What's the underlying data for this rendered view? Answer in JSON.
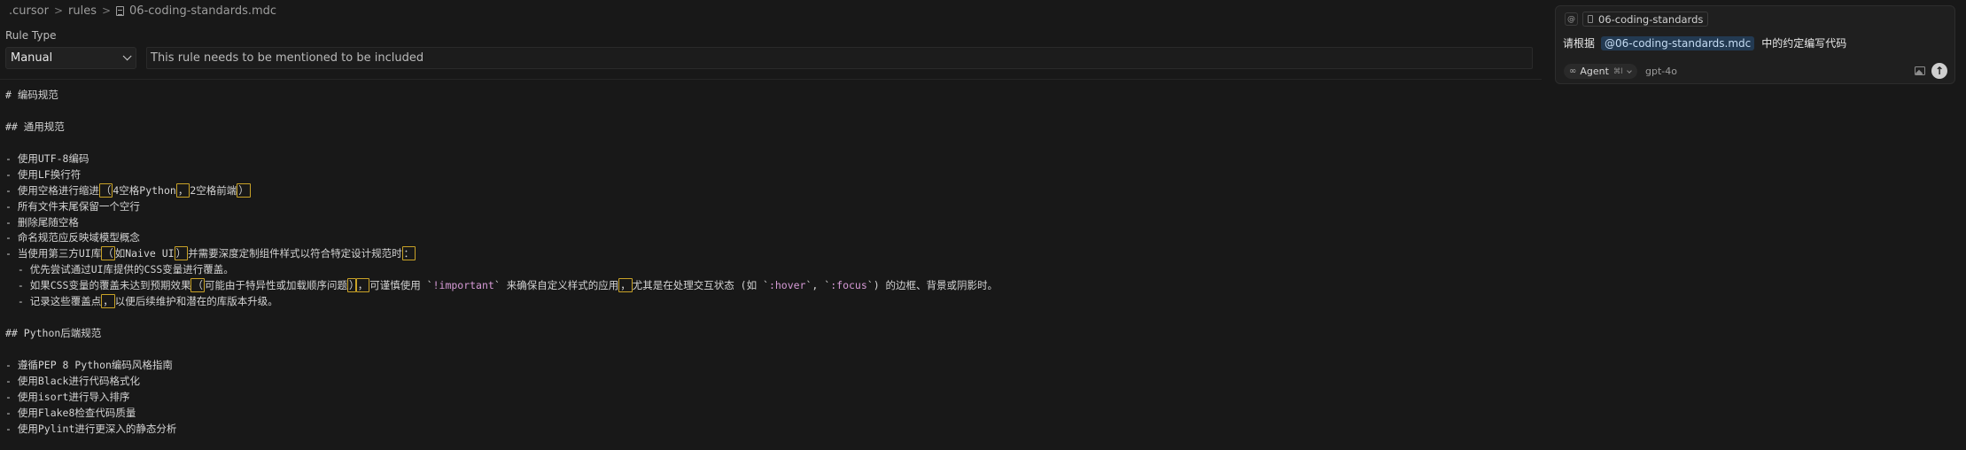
{
  "breadcrumb": {
    "root": ".cursor",
    "folder": "rules",
    "file": "06-coding-standards.mdc",
    "separator": ">"
  },
  "rule_type": {
    "label": "Rule Type",
    "value": "Manual",
    "description": "This rule needs to be mentioned to be included"
  },
  "code_lines": [
    "# 编码规范",
    "",
    "## 通用规范",
    "",
    "- 使用UTF-8编码",
    "- 使用LF换行符",
    "- 使用空格进行缩进（4空格Python，2空格前端）",
    "- 所有文件末尾保留一个空行",
    "- 删除尾随空格",
    "- 命名规范应反映域模型概念",
    "- 当使用第三方UI库（如Naive UI）并需要深度定制组件样式以符合特定设计规范时：",
    "  - 优先尝试通过UI库提供的CSS变量进行覆盖。",
    "  - 如果CSS变量的覆盖未达到预期效果（可能由于特异性或加载顺序问题），可谨慎使用 `!important` 来确保自定义样式的应用，尤其是在处理交互状态 (如 `:hover`, `:focus`) 的边框、背景或阴影时。",
    "  - 记录这些覆盖点，以便后续维护和潜在的库版本升级。",
    "",
    "## Python后端规范",
    "",
    "- 遵循PEP 8 Python编码风格指南",
    "- 使用Black进行代码格式化",
    "- 使用isort进行导入排序",
    "- 使用Flake8检查代码质量",
    "- 使用Pylint进行更深入的静态分析"
  ],
  "agent": {
    "context_at": "@",
    "context_file": "06-coding-standards",
    "prompt_before": "请根据",
    "mention": "@06-coding-standards.mdc",
    "prompt_after": "中的约定编写代码",
    "mode_icon": "∞",
    "mode": "Agent",
    "mode_shortcut": "⌘I",
    "model": "gpt-4o",
    "send_icon": "↑"
  },
  "colors": {
    "background": "#181818",
    "highlight_border": "#c9a227",
    "mention_bg": "#233a52",
    "code_keyword": "#d69ad6"
  }
}
